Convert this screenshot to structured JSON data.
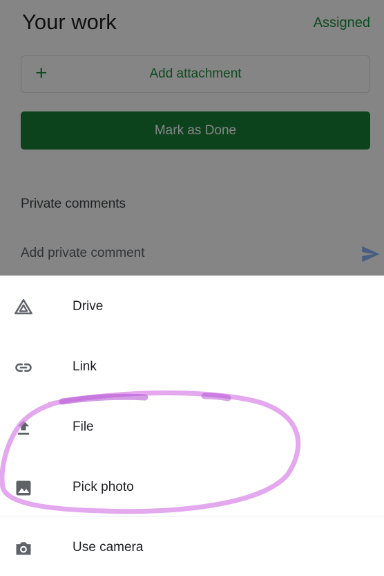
{
  "background": {
    "title": "Your work",
    "status": "Assigned",
    "add_attachment": {
      "icon": "plus-icon",
      "plus_glyph": "+",
      "label": "Add attachment"
    },
    "mark_done_label": "Mark as Done",
    "private_comments_label": "Private comments",
    "comment_placeholder": "Add private comment",
    "send_icon": "send-icon"
  },
  "menu": {
    "items": [
      {
        "label": "Drive",
        "icon": "drive-icon"
      },
      {
        "label": "Link",
        "icon": "link-icon"
      },
      {
        "label": "File",
        "icon": "upload-icon"
      },
      {
        "label": "Pick photo",
        "icon": "image-icon"
      },
      {
        "label": "Use camera",
        "icon": "camera-icon"
      }
    ]
  },
  "colors": {
    "accent": "#1e8e3e",
    "primary_button": "#188038",
    "scrim": "rgba(0,0,0,0.48)",
    "annotation_highlight": "#d98be8"
  }
}
